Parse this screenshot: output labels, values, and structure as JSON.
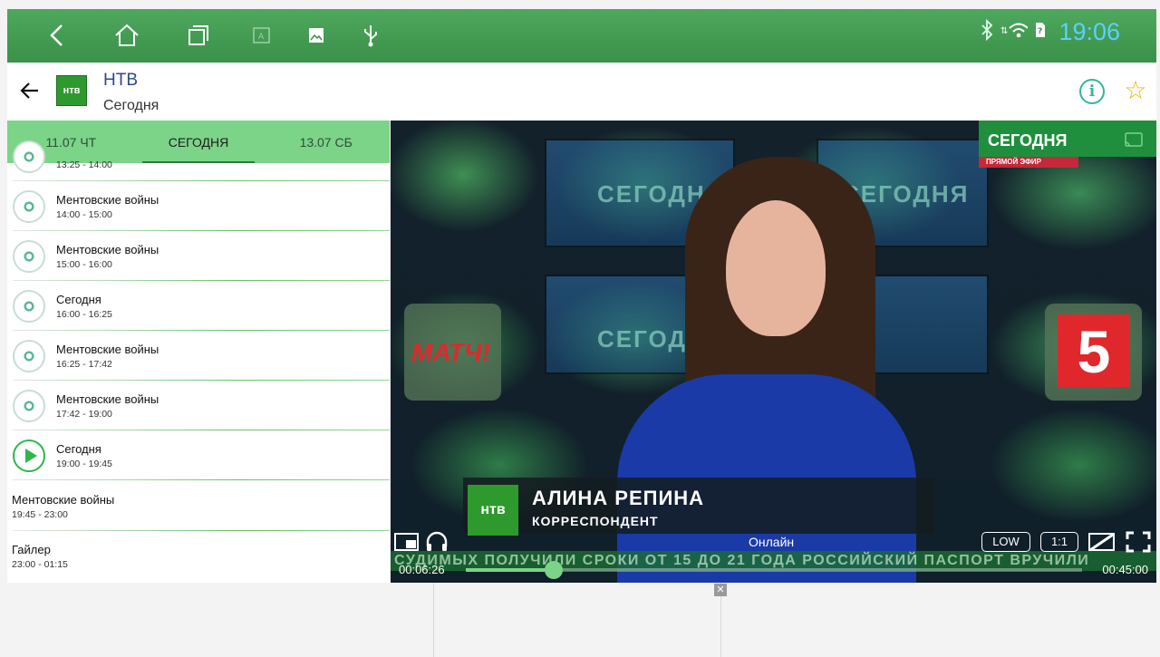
{
  "status_bar": {
    "clock": "19:06",
    "icons": [
      "back-icon",
      "home-icon",
      "recents-icon",
      "screenshot-icon",
      "gallery-icon",
      "usb-icon",
      "bluetooth-icon",
      "wifi-icon",
      "sim-icon"
    ],
    "accent": "#5ad0ff"
  },
  "header": {
    "channel_name": "НТВ",
    "subtitle": "Сегодня",
    "logo_text": "нтв"
  },
  "tabs": [
    {
      "label": "11.07 ЧТ",
      "active": false
    },
    {
      "label": "СЕГОДНЯ",
      "active": true
    },
    {
      "label": "13.07 СБ",
      "active": false
    }
  ],
  "schedule": [
    {
      "title": "",
      "time": "13:25 - 14:00",
      "icon": "past"
    },
    {
      "title": "Ментовские войны",
      "time": "14:00 - 15:00",
      "icon": "past"
    },
    {
      "title": "Ментовские войны",
      "time": "15:00 - 16:00",
      "icon": "past"
    },
    {
      "title": "Сегодня",
      "time": "16:00 - 16:25",
      "icon": "past"
    },
    {
      "title": "Ментовские войны",
      "time": "16:25 - 17:42",
      "icon": "past"
    },
    {
      "title": "Ментовские войны",
      "time": "17:42 - 19:00",
      "icon": "past"
    },
    {
      "title": "Сегодня",
      "time": "19:00 - 19:45",
      "icon": "play"
    },
    {
      "title": "Ментовские войны",
      "time": "19:45 - 23:00",
      "icon": "none"
    },
    {
      "title": "Гайлер",
      "time": "23:00 - 01:15",
      "icon": "none"
    }
  ],
  "video": {
    "onair_title": "СЕГОДНЯ",
    "onair_sub": "ПРЯМОЙ ЭФИР",
    "screen_text": "СЕГОДНЯ",
    "prev_channel": "МАТЧ!",
    "next_channel": "5",
    "lower_third_logo": "нтв",
    "lower_third_name": "АЛИНА РЕПИНА",
    "lower_third_role": "КОРРЕСПОНДЕНТ",
    "ticker": "СУДИМЫХ ПОЛУЧИЛИ СРОКИ ОТ 15 ДО 21 ГОДА    РОССИЙСКИЙ ПАСПОРТ  ВРУЧИЛИ"
  },
  "player": {
    "status": "Онлайн",
    "current_time": "00:06:26",
    "end_time": "00:45:00",
    "progress": 0.143,
    "quality": "LOW",
    "aspect": "1:1"
  }
}
